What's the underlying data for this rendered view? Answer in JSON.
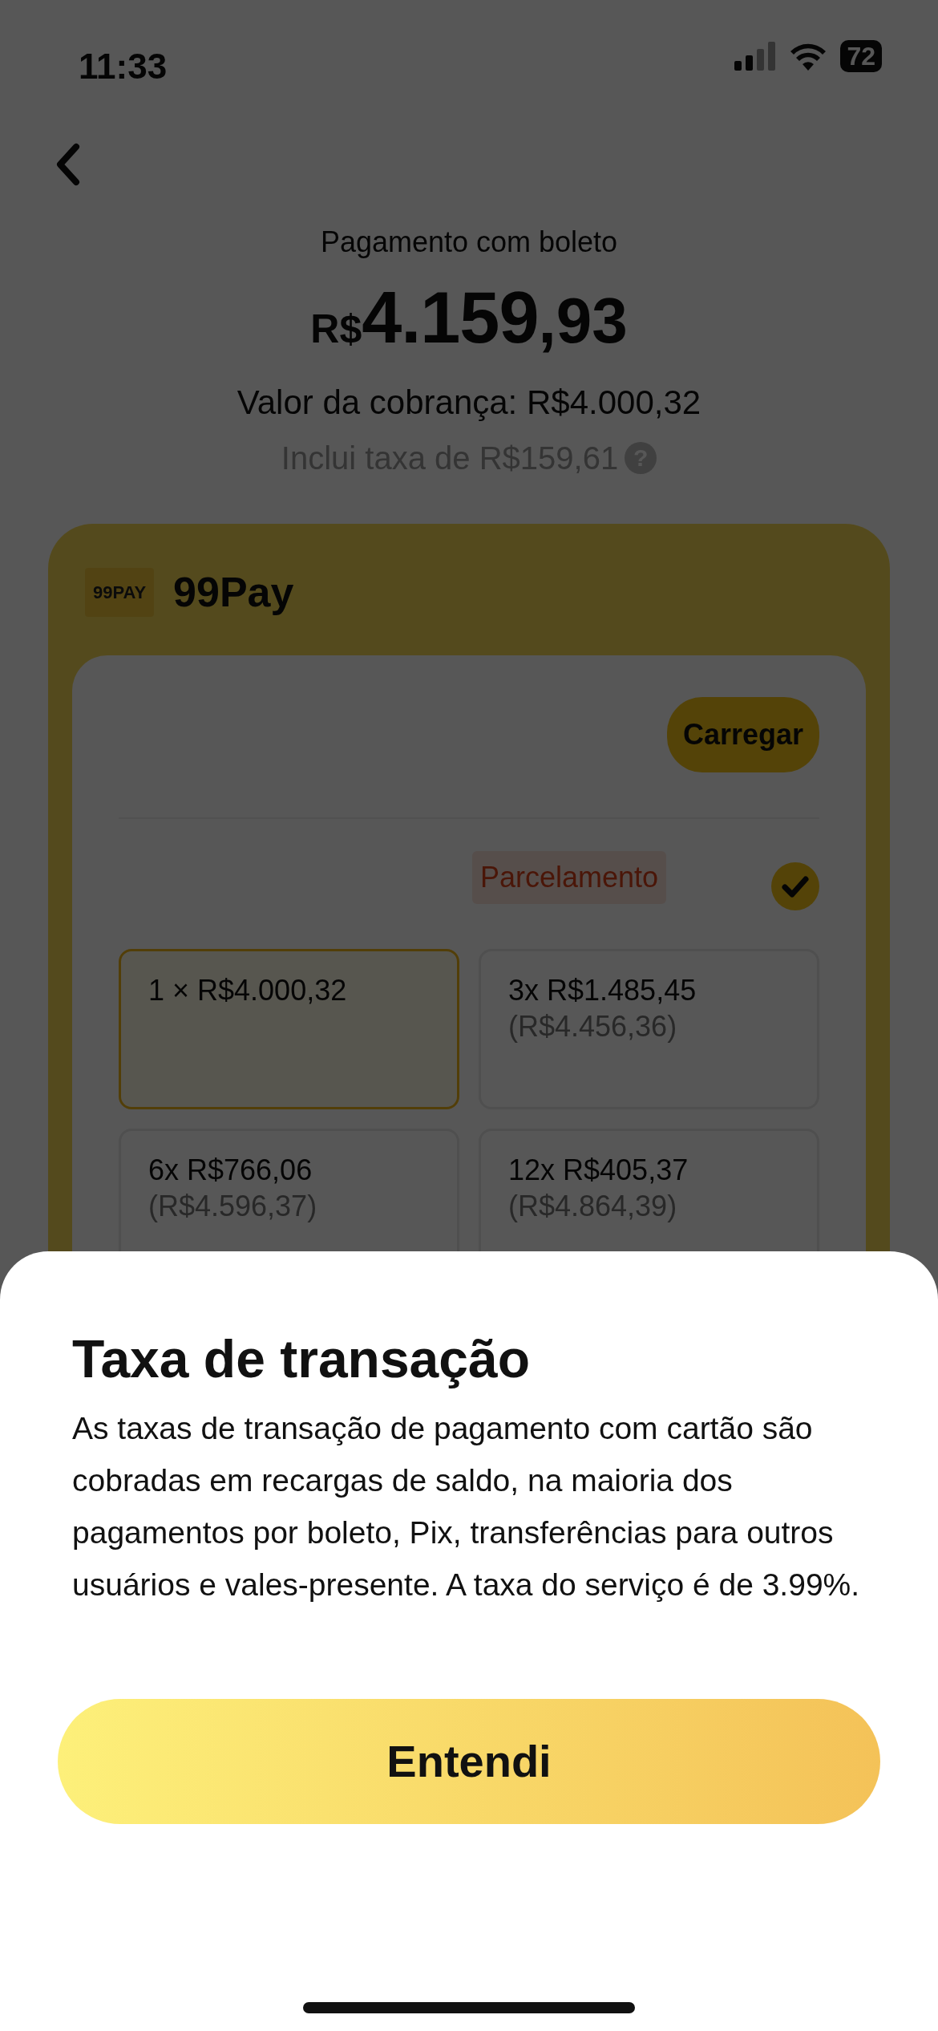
{
  "status_bar": {
    "time": "11:33",
    "battery": "72"
  },
  "header": {
    "subtitle": "Pagamento com boleto",
    "amount": {
      "currency": "R$",
      "whole": "4.159",
      "cents": ",93"
    },
    "charge": "Valor da cobrança: R$4.000,32",
    "fee": "Inclui taxa de R$159,61",
    "fee_help": "?"
  },
  "wallet": {
    "logo_text": "99PAY",
    "name": "99Pay",
    "load_button": "Carregar",
    "tag": "Parcelamento",
    "checked": true,
    "options": [
      {
        "label": "1 × R$4.000,32",
        "selected": true
      },
      {
        "label": "3x R$1.485,45",
        "total": "(R$4.456,36)",
        "selected": false
      },
      {
        "label": "6x R$766,06",
        "total": "(R$4.596,37)",
        "selected": false
      },
      {
        "label": "12x R$405,37",
        "total": "(R$4.864,39)",
        "selected": false
      }
    ]
  },
  "sheet": {
    "title": "Taxa de transação",
    "body": "As taxas de transação de pagamento com cartão são cobradas em recargas de saldo, na maioria dos pagamentos por boleto, Pix, transferências para outros usuários e vales-presente. A taxa do serviço é de 3.99%.",
    "button": "Entendi"
  }
}
